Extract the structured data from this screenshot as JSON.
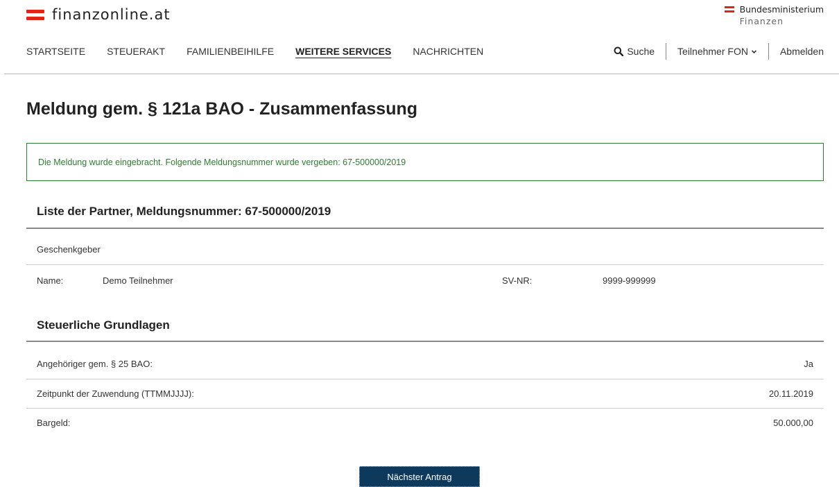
{
  "header": {
    "logo_text": "finanzonline.at",
    "ministry_line1": "Bundesministerium",
    "ministry_line2": "Finanzen",
    "brand_color": "#e2231a"
  },
  "nav": {
    "items": [
      {
        "label": "STARTSEITE"
      },
      {
        "label": "STEUERAKT"
      },
      {
        "label": "FAMILIENBEIHILFE"
      },
      {
        "label": "WEITERE SERVICES",
        "active": true
      },
      {
        "label": "NACHRICHTEN"
      }
    ],
    "search_label": "Suche",
    "search_icon": "search-icon",
    "user_label": "Teilnehmer FON",
    "user_icon": "chevron-down-icon",
    "logout_label": "Abmelden"
  },
  "main": {
    "title": "Meldung gem. § 121a BAO - Zusammenfassung",
    "success_message": "Die Meldung wurde eingebracht. Folgende Meldungsnummer wurde vergeben: 67-500000/2019",
    "success_color": "#2e7d32",
    "partners": {
      "title": "Liste der Partner, Meldungsnummer: 67-500000/2019",
      "role": "Geschenkgeber",
      "name_label": "Name:",
      "name_value": "Demo Teilnehmer",
      "sv_label": "SV-NR:",
      "sv_value": "9999-999999"
    },
    "tax": {
      "title": "Steuerliche Grundlagen",
      "rows": [
        {
          "label": "Angehöriger gem. § 25 BAO:",
          "value": "Ja"
        },
        {
          "label": "Zeitpunkt der Zuwendung (TTMMJJJJ):",
          "value": "20.11.2019"
        },
        {
          "label": "Bargeld:",
          "value": "50.000,00"
        }
      ]
    },
    "next_button": "Nächster Antrag",
    "button_color": "#0d3a5c"
  }
}
